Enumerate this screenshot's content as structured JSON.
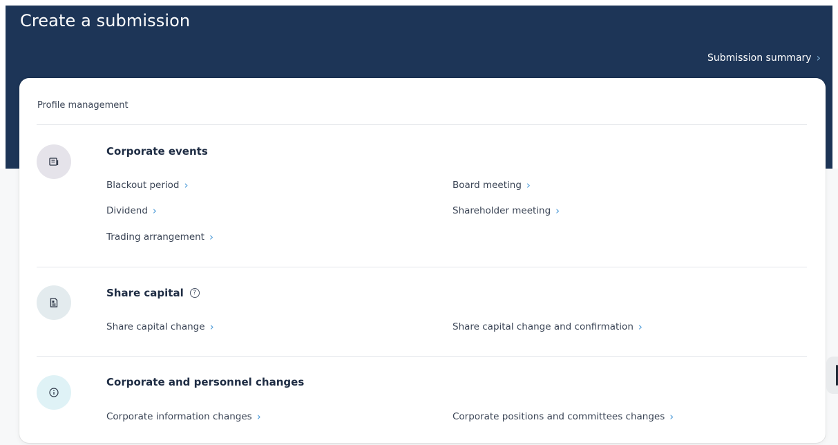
{
  "header": {
    "title": "Create a submission",
    "summary_link": "Submission summary",
    "chevron": "›"
  },
  "card": {
    "heading": "Profile management",
    "sections": [
      {
        "title": "Corporate events",
        "icon": "newspaper-icon",
        "icon_bg": "#e5e3ea",
        "links": [
          "Blackout period",
          "Board meeting",
          "Dividend",
          "Shareholder meeting",
          "Trading arrangement"
        ]
      },
      {
        "title": "Share capital",
        "icon": "document-share-icon",
        "icon_bg": "#e3ebee",
        "help_glyph": "?",
        "links": [
          "Share capital change",
          "Share capital change and confirmation"
        ]
      },
      {
        "title": "Corporate and personnel changes",
        "icon": "info-icon",
        "icon_bg": "#dff2f6",
        "links": [
          "Corporate information changes",
          "Corporate positions and committees changes"
        ]
      }
    ]
  },
  "colors": {
    "header_bg": "#1d3557",
    "chevron_accent": "#4d9bd8",
    "text_primary": "#1f2d44"
  }
}
